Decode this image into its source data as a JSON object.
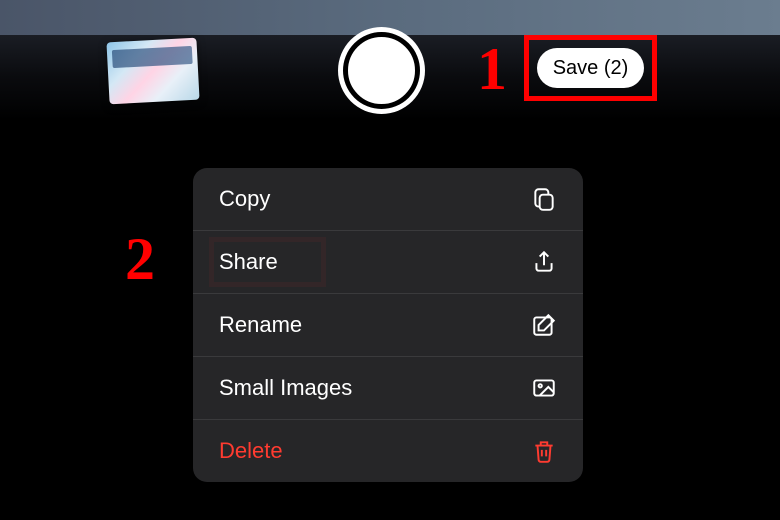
{
  "top_bar": {
    "save_label": "Save (2)"
  },
  "annotations": {
    "step1": "1",
    "step2": "2"
  },
  "context_menu": {
    "items": [
      {
        "label": "Copy",
        "icon": "copy-icon",
        "destructive": false
      },
      {
        "label": "Share",
        "icon": "share-icon",
        "destructive": false
      },
      {
        "label": "Rename",
        "icon": "rename-icon",
        "destructive": false
      },
      {
        "label": "Small Images",
        "icon": "image-icon",
        "destructive": false
      },
      {
        "label": "Delete",
        "icon": "trash-icon",
        "destructive": true
      }
    ]
  }
}
